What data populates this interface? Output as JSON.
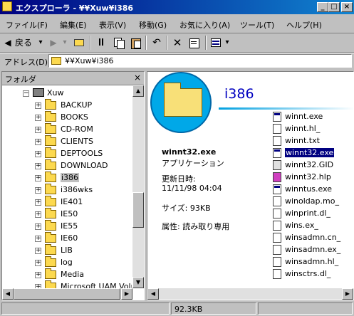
{
  "window": {
    "title": "エクスプローラ - ¥¥Xuw¥i386",
    "min": "_",
    "max": "□",
    "close": "×"
  },
  "menu": [
    "ファイル(F)",
    "編集(E)",
    "表示(V)",
    "移動(G)",
    "お気に入り(A)",
    "ツール(T)",
    "ヘルプ(H)"
  ],
  "toolbar": {
    "back": "戻る",
    "back_arrow": "◀",
    "forward_arrow": "▶",
    "dropdown": "▾"
  },
  "address": {
    "label": "アドレス(D)",
    "value": "¥¥Xuw¥i386"
  },
  "folder_pane": {
    "title": "フォルダ",
    "close": "×",
    "root": "Xuw",
    "items": [
      "BACKUP",
      "BOOKS",
      "CD-ROM",
      "CLIENTS",
      "DEPTOOLS",
      "DOWNLOAD",
      "i386",
      "i386wks",
      "IE401",
      "IE50",
      "IE55",
      "IE60",
      "LIB",
      "log",
      "Media",
      "Microsoft UAM Volume"
    ],
    "selected": "i386"
  },
  "content": {
    "folder_name": "i386",
    "selected_file": "winnt32.exe",
    "file_type": "アプリケーション",
    "modified_label": "更新日時:",
    "modified_value": "11/11/98 04:04",
    "size_line": "サイズ: 93KB",
    "attr_line": "属性: 読み取り専用",
    "files": [
      {
        "name": "winnt.exe",
        "icon": "exe"
      },
      {
        "name": "winnt.hl_",
        "icon": "doc"
      },
      {
        "name": "winnt.txt",
        "icon": "doc"
      },
      {
        "name": "winnt32.exe",
        "icon": "exe",
        "selected": true
      },
      {
        "name": "winnt32.GID",
        "icon": "gid"
      },
      {
        "name": "winnt32.hlp",
        "icon": "hlp"
      },
      {
        "name": "winntus.exe",
        "icon": "exe"
      },
      {
        "name": "winoldap.mo_",
        "icon": "doc"
      },
      {
        "name": "winprint.dl_",
        "icon": "doc"
      },
      {
        "name": "wins.ex_",
        "icon": "doc"
      },
      {
        "name": "winsadmn.cn_",
        "icon": "doc"
      },
      {
        "name": "winsadmn.ex_",
        "icon": "doc"
      },
      {
        "name": "winsadmn.hl_",
        "icon": "doc"
      },
      {
        "name": "winsctrs.dl_",
        "icon": "doc"
      }
    ]
  },
  "status": {
    "size": "92.3KB"
  }
}
